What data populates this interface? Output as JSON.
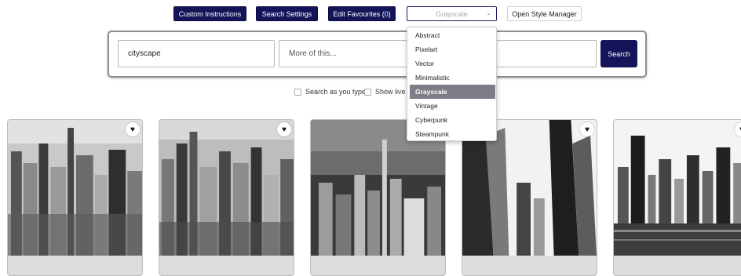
{
  "toolbar": {
    "custom_instructions": "Custom Instructions",
    "search_settings": "Search Settings",
    "edit_favourites": "Edit Favourites (0)",
    "style_select_value": "Grayscale",
    "open_style_manager": "Open Style Manager"
  },
  "search": {
    "query_value": "cityscape",
    "more_placeholder": "More of this...",
    "third_placeholder": "",
    "button_label": "Search"
  },
  "options": {
    "search_as_you_type": "Search as you type",
    "show_live": "Show live r"
  },
  "style_dropdown": {
    "selected": "Grayscale",
    "items": [
      "Abstract",
      "Pixelart",
      "Vector",
      "Minimalistic",
      "Grayscale",
      "Vintage",
      "Cyberpunk",
      "Steampunk"
    ]
  },
  "results": [
    {
      "favourite_icon": "heart-icon",
      "subject": "grayscale aerial cityscape"
    },
    {
      "favourite_icon": "heart-icon",
      "subject": "grayscale aerial cityscape"
    },
    {
      "favourite_icon": "heart-icon",
      "subject": "grayscale skyline at dusk"
    },
    {
      "favourite_icon": "heart-icon",
      "subject": "grayscale skyscrapers from below"
    },
    {
      "favourite_icon": "heart-icon",
      "subject": "grayscale waterfront skyline"
    }
  ],
  "colors": {
    "brand_navy": "#14145a",
    "selected_item": "#7d7d85",
    "panel_border": "#8d8d8d"
  }
}
